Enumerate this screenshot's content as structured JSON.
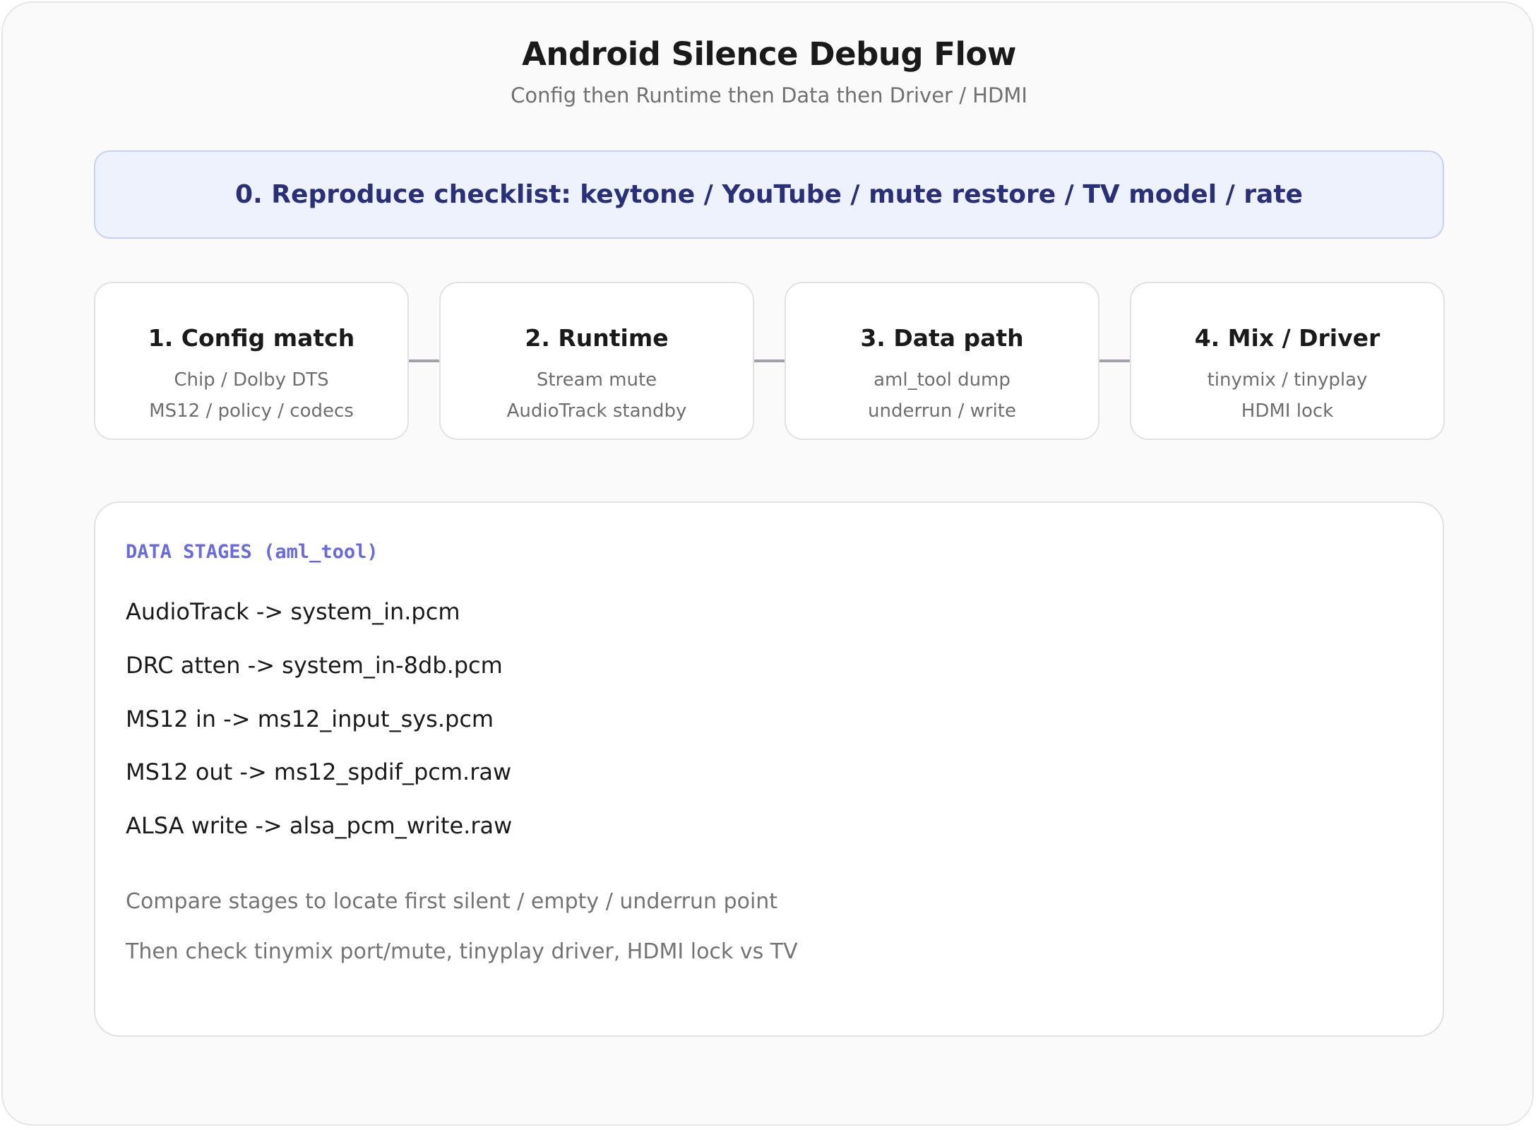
{
  "header": {
    "title": "Android Silence Debug Flow",
    "subtitle": "Config then Runtime then Data then Driver / HDMI"
  },
  "banner": {
    "text": "0. Reproduce checklist: keytone / YouTube / mute restore / TV model / rate"
  },
  "steps": [
    {
      "title": "1. Config match",
      "line1": "Chip / Dolby DTS",
      "line2": "MS12 / policy / codecs"
    },
    {
      "title": "2. Runtime",
      "line1": "Stream mute",
      "line2": "AudioTrack standby"
    },
    {
      "title": "3. Data path",
      "line1": "aml_tool dump",
      "line2": "underrun / write"
    },
    {
      "title": "4. Mix / Driver",
      "line1": "tinymix / tinyplay",
      "line2": "HDMI lock"
    }
  ],
  "panel": {
    "heading": "DATA STAGES (aml_tool)",
    "stages": [
      "AudioTrack -> system_in.pcm",
      "DRC atten -> system_in-8db.pcm",
      "MS12 in -> ms12_input_sys.pcm",
      "MS12 out -> ms12_spdif_pcm.raw",
      "ALSA write -> alsa_pcm_write.raw"
    ],
    "notes": [
      "Compare stages to locate first silent / empty / underrun point",
      "Then check tinymix port/mute, tinyplay driver, HDMI lock vs TV"
    ]
  },
  "colors": {
    "banner_bg": "#eef2fd",
    "banner_text": "#2a2f7a",
    "heading_accent": "#6a6ae0",
    "connector": "#a3a0ab"
  }
}
